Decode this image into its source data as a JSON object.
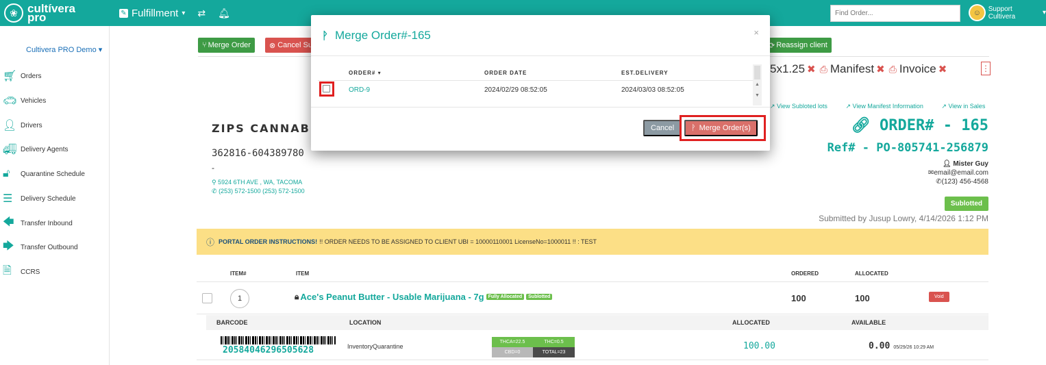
{
  "topbar": {
    "logo_line1": "cultívera",
    "logo_line2": "pro",
    "module": "Fulfillment",
    "find_placeholder": "Find Order...",
    "user_name": "Support Cultivera"
  },
  "sidebar": {
    "company": "Cultivera PRO Demo",
    "items": [
      {
        "label": "Orders",
        "icon": "cart-icon"
      },
      {
        "label": "Vehicles",
        "icon": "car-icon"
      },
      {
        "label": "Drivers",
        "icon": "user-icon"
      },
      {
        "label": "Delivery Agents",
        "icon": "truck-icon"
      },
      {
        "label": "Quarantine Schedule",
        "icon": "unlock-icon"
      },
      {
        "label": "Delivery Schedule",
        "icon": "list-icon"
      },
      {
        "label": "Transfer Inbound",
        "icon": "arrow-left-icon"
      },
      {
        "label": "Transfer Outbound",
        "icon": "arrow-right-icon"
      },
      {
        "label": "CCRS",
        "icon": "file-icon"
      }
    ]
  },
  "toolbar": {
    "merge_label": "Merge Order",
    "cancel_label": "Cancel Su",
    "reassign_label": "Reassign client"
  },
  "labels": {
    "size": "5x1.25",
    "manifest": "Manifest",
    "invoice": "Invoice"
  },
  "links": {
    "sublotted": "View Subloted lots",
    "manifest_info": "View Manifest Information",
    "in_sales": "View in Sales"
  },
  "order": {
    "title": "ORDER# - 165",
    "ref": "Ref# - PO-805741-256879",
    "contact_name": "Mister Guy",
    "email": "email@email.com",
    "phone": "(123) 456-4568",
    "status": "Sublotted",
    "submitted": "Submitted by Jusup Lowry, 4/14/2026 1:12 PM"
  },
  "client": {
    "name": "ZIPS CANNABIS",
    "ubi": "362816-604389780",
    "dash": "-",
    "address": "5924 6TH AVE , WA, TACOMA",
    "phones": "(253) 572-1500  (253) 572-1500"
  },
  "portal": {
    "label": "PORTAL ORDER INSTRUCTIONS!",
    "text": "!! ORDER NEEDS TO BE ASSIGNED TO CLIENT UBI = 10000110001 LicenseNo=1000011 !! : TEST"
  },
  "items_table": {
    "headers": {
      "item_no": "ITEM#",
      "item": "ITEM",
      "ordered": "ORDERED",
      "allocated": "ALLOCATED"
    },
    "row": {
      "number": "1",
      "name": "Ace's Peanut Butter - Usable Marijuana - 7g",
      "tag1": "Fully Allocated",
      "tag2": "Sublotted",
      "ordered": "100",
      "allocated": "100",
      "void": "Void"
    },
    "sub_headers": {
      "barcode": "BARCODE",
      "location": "LOCATION",
      "allocated": "ALLOCATED",
      "available": "AVAILABLE"
    },
    "sub_row": {
      "barcode": "20584046296505628",
      "location": "InventoryQuarantine",
      "thca": "THCA=22.5",
      "thc": "THC=0.5",
      "cbd": "CBD=0",
      "total": "TOTAL=23",
      "allocated": "100.00",
      "available": "0.00",
      "available_ts": "05/29/26 10:29 AM"
    }
  },
  "modal": {
    "title": "Merge Order#-165",
    "headers": {
      "order": "ORDER# ▾",
      "date": "ORDER DATE",
      "est": "EST.DELIVERY"
    },
    "row": {
      "order": "ORD-9",
      "date": "2024/02/29 08:52:05",
      "est": "2024/03/03 08:52:05"
    },
    "cancel_label": "Cancel",
    "merge_label": "Merge Order(s)"
  },
  "colors": {
    "brand": "#14a89c",
    "danger": "#d9534f",
    "success": "#3e9b45",
    "highlight": "#e02020"
  }
}
